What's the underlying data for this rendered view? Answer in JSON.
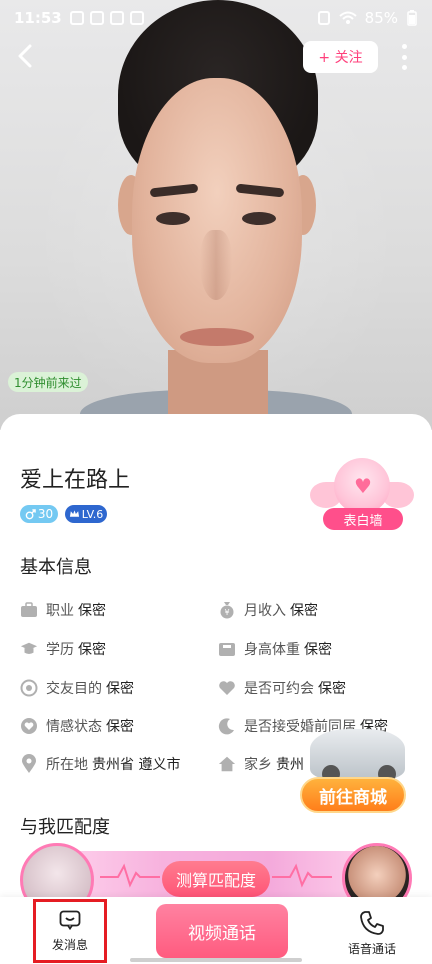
{
  "status_bar": {
    "time": "11:53",
    "battery": "85%"
  },
  "header": {
    "follow_label": "+ 关注"
  },
  "photo": {
    "visited_label": "1分钟前来过"
  },
  "profile": {
    "name": "爱上在路上",
    "age": "30",
    "level": "LV.6",
    "love_wall_label": "表白墙"
  },
  "basic_info": {
    "title": "基本信息",
    "items": [
      {
        "label": "职业",
        "value": "保密",
        "icon": "briefcase-icon"
      },
      {
        "label": "月收入",
        "value": "保密",
        "icon": "money-bag-icon"
      },
      {
        "label": "学历",
        "value": "保密",
        "icon": "graduation-cap-icon"
      },
      {
        "label": "身高体重",
        "value": "保密",
        "icon": "scale-icon"
      },
      {
        "label": "交友目的",
        "value": "保密",
        "icon": "target-icon"
      },
      {
        "label": "是否可约会",
        "value": "保密",
        "icon": "heart-icon"
      },
      {
        "label": "情感状态",
        "value": "保密",
        "icon": "heart-badge-icon"
      },
      {
        "label": "是否接受婚前同居",
        "value": "保密",
        "icon": "moon-icon"
      },
      {
        "label": "所在地",
        "value": "贵州省 遵义市",
        "icon": "location-icon"
      },
      {
        "label": "家乡",
        "value": "贵州",
        "icon": "home-icon"
      }
    ]
  },
  "shop_promo": {
    "label": "前往商城"
  },
  "match": {
    "title": "与我匹配度",
    "button_label": "测算匹配度"
  },
  "bottom_bar": {
    "send_message_label": "发消息",
    "video_call_label": "视频通话",
    "voice_call_label": "语音通话"
  }
}
